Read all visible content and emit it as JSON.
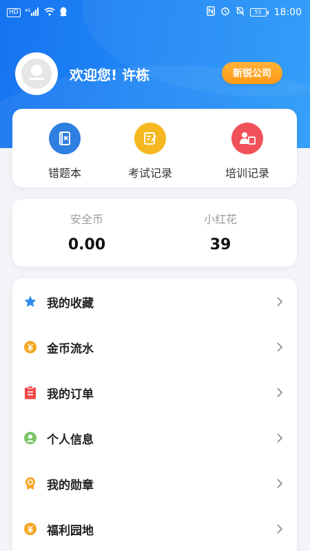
{
  "status_bar": {
    "left": [
      "HD",
      "4G",
      "wifi-icon",
      "qq-icon"
    ],
    "time": "18:00",
    "battery": "55",
    "icons": [
      "nfc-icon",
      "alarm-icon",
      "mute-icon"
    ]
  },
  "profile": {
    "greeting": "欢迎您! 许栋",
    "company": "新锐公司"
  },
  "quick_actions": [
    {
      "label": "错题本",
      "icon": "wrong-book-icon",
      "color": "#2f7fe0"
    },
    {
      "label": "考试记录",
      "icon": "exam-record-icon",
      "color": "#f6b821"
    },
    {
      "label": "培训记录",
      "icon": "training-record-icon",
      "color": "#f1525a"
    }
  ],
  "stats": [
    {
      "name": "安全币",
      "value": "0.00"
    },
    {
      "name": "小红花",
      "value": "39"
    }
  ],
  "menu": [
    {
      "label": "我的收藏",
      "icon": "star-icon",
      "color": "#2f8cf0"
    },
    {
      "label": "金币流水",
      "icon": "coin-icon",
      "color": "#f5a623"
    },
    {
      "label": "我的订单",
      "icon": "order-icon",
      "color": "#f04848"
    },
    {
      "label": "个人信息",
      "icon": "user-icon",
      "color": "#7cc36a"
    },
    {
      "label": "我的勋章",
      "icon": "medal-icon",
      "color": "#f5a623"
    },
    {
      "label": "福利园地",
      "icon": "welfare-icon",
      "color": "#f5a623"
    }
  ]
}
